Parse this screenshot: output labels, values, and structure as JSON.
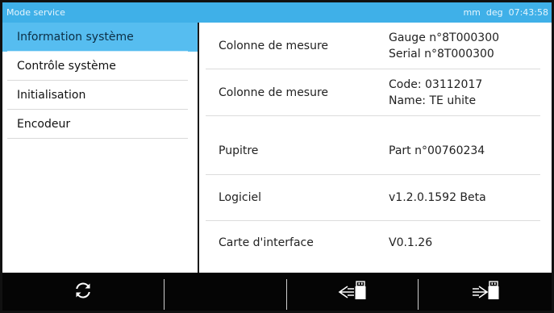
{
  "window": {
    "title": "Mode service",
    "status": "mm  deg  07:43:58"
  },
  "sidebar": {
    "items": [
      {
        "label": "Information système",
        "active": true
      },
      {
        "label": "Contrôle système",
        "active": false
      },
      {
        "label": "Initialisation",
        "active": false
      },
      {
        "label": "Encodeur",
        "active": false
      }
    ]
  },
  "info": {
    "rows": [
      {
        "label": "Colonne de mesure",
        "value_line1": "Gauge n°8T000300",
        "value_line2": "Serial n°8T000300"
      },
      {
        "label": "Colonne de mesure",
        "value_line1": "Code: 03112017",
        "value_line2": "Name: TE uhite"
      },
      {
        "label": "Pupitre",
        "value_line1": "Part n°00760234",
        "value_line2": ""
      },
      {
        "label": "Logiciel",
        "value_line1": "v1.2.0.1592 Beta",
        "value_line2": ""
      },
      {
        "label": "Carte d'interface",
        "value_line1": "V0.1.26",
        "value_line2": ""
      }
    ]
  },
  "toolbar": {
    "refresh_icon": "refresh-icon",
    "usb_import_icon": "usb-import-icon",
    "usb_export_icon": "usb-export-icon"
  },
  "colors": {
    "title_bar": "#3fb0e8",
    "active_item": "#56bdf0",
    "toolbar_bg": "#050505"
  }
}
